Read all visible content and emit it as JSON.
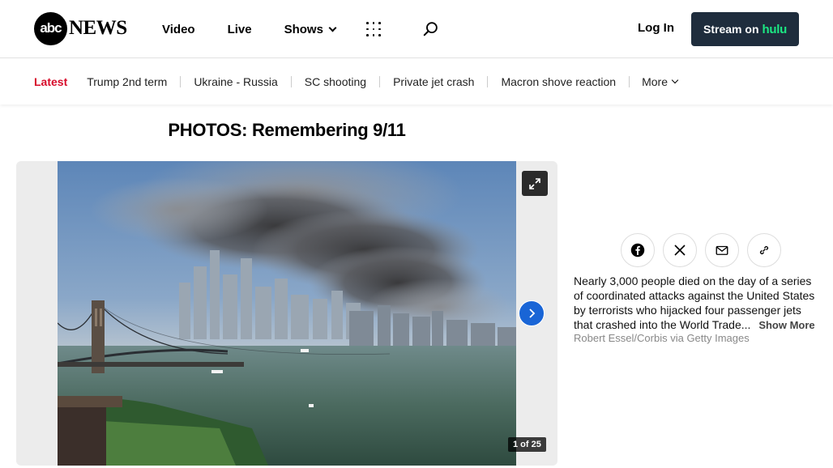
{
  "header": {
    "logo_abc": "abc",
    "logo_news": "NEWS",
    "nav": [
      "Video",
      "Live",
      "Shows"
    ],
    "login": "Log In",
    "stream_prefix": "Stream on",
    "stream_brand": "hulu"
  },
  "subnav": {
    "latest": "Latest",
    "links": [
      "Trump 2nd term",
      "Ukraine - Russia",
      "SC shooting",
      "Private jet crash",
      "Macron shove reaction"
    ],
    "more": "More"
  },
  "gallery": {
    "title": "PHOTOS: Remembering 9/11",
    "counter": "1 of 25"
  },
  "caption": {
    "text": "Nearly 3,000 people died on the day of a series of coordinated attacks against the United States by terrorists who hijacked four passenger jets that crashed into the World Trade...",
    "show_more": "Show More",
    "credit": "Robert Essel/Corbis via Getty Images"
  },
  "icons": {
    "facebook": "facebook-icon",
    "x": "x-icon",
    "email": "mail-icon",
    "link": "link-icon",
    "expand": "expand-icon",
    "next": "chevron-right-icon",
    "search": "search-icon",
    "apps": "grid-icon"
  },
  "colors": {
    "accent_red": "#d70b2a",
    "stream_bg": "#1f2d3d",
    "hulu_green": "#1ce783",
    "next_blue": "#1965d6"
  }
}
